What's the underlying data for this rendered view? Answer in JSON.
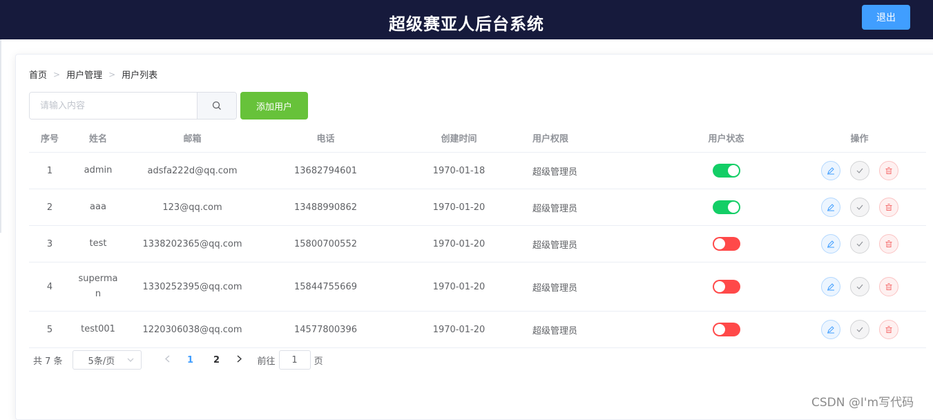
{
  "header": {
    "title": "超级赛亚人后台系统",
    "logout_label": "退出"
  },
  "breadcrumb": [
    "首页",
    "用户管理",
    "用户列表"
  ],
  "search": {
    "placeholder": "请输入内容",
    "add_label": "添加用户"
  },
  "table": {
    "columns": [
      "序号",
      "姓名",
      "邮箱",
      "电话",
      "创建时间",
      "用户权限",
      "用户状态",
      "操作"
    ],
    "rows": [
      {
        "index": "1",
        "name": "admin",
        "email": "adsfa222d@qq.com",
        "phone": "13682794601",
        "created": "1970-01-18",
        "role": "超级管理员",
        "status": true
      },
      {
        "index": "2",
        "name": "aaa",
        "email": "123@qq.com",
        "phone": "13488990862",
        "created": "1970-01-20",
        "role": "超级管理员",
        "status": true
      },
      {
        "index": "3",
        "name": "test",
        "email": "1338202365@qq.com",
        "phone": "15800700552",
        "created": "1970-01-20",
        "role": "超级管理员",
        "status": false
      },
      {
        "index": "4",
        "name": "superman",
        "email": "1330252395@qq.com",
        "phone": "15844755669",
        "created": "1970-01-20",
        "role": "超级管理员",
        "status": false
      },
      {
        "index": "5",
        "name": "test001",
        "email": "1220306038@qq.com",
        "phone": "14577800396",
        "created": "1970-01-20",
        "role": "超级管理员",
        "status": false
      }
    ]
  },
  "pagination": {
    "total_label": "共 7 条",
    "page_size": "5条/页",
    "pages": [
      "1",
      "2"
    ],
    "current_page": "1",
    "jump_prefix": "前往",
    "jump_value": "1",
    "jump_suffix": "页"
  },
  "watermark": "CSDN @I'm写代码",
  "colors": {
    "header_bg": "#161a3c",
    "primary": "#409eff",
    "success": "#67c23a",
    "switch_on": "#13ce66",
    "switch_off": "#ff4949"
  }
}
